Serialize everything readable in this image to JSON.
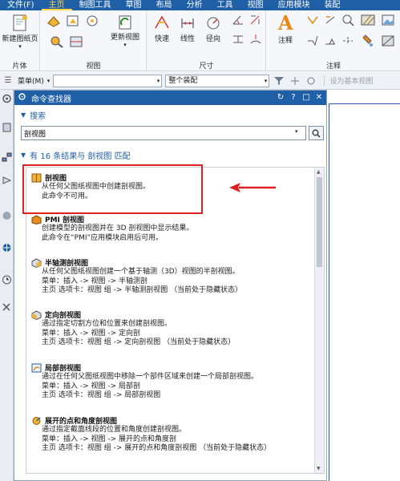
{
  "menubar": {
    "items": [
      "文件(F)",
      "主页",
      "制图工具",
      "草图",
      "布局",
      "分析",
      "工具",
      "视图",
      "应用模块",
      "装配"
    ],
    "active": "主页"
  },
  "ribbon": {
    "groups": [
      {
        "label": "片体",
        "buttons": [
          "新建图纸页"
        ]
      },
      {
        "label": "视图",
        "buttons": [
          "更新视图"
        ]
      },
      {
        "label": "尺寸",
        "buttons": [
          "快速",
          "线性",
          "径向"
        ]
      },
      {
        "label": "注释",
        "buttons": [
          "注释"
        ]
      }
    ]
  },
  "selbar": {
    "menu_label": "菜单(M)",
    "filter_value": "",
    "scope_value": "整个装配",
    "set_base_view": "设为基本视图"
  },
  "panel": {
    "title": "命令查找器",
    "search_section": "搜索",
    "search_value": "剖视图",
    "results_header": "有 16 条结果与 剖视图 匹配",
    "results": [
      {
        "title": "剖视图",
        "lines": [
          "从任何父图纸视图中创建剖视图。",
          "此命令不可用。"
        ],
        "icon": "section-view-icon"
      },
      {
        "title": "PMI 剖视图",
        "lines": [
          "创建模型的剖视图并在 3D 剖视图中显示结果。",
          "此命令在“PMI”应用模块启用后可用。"
        ],
        "icon": "pmi-section-icon"
      },
      {
        "title": "半轴测剖视图",
        "lines": [
          "从任何父图纸视图创建一个基于轴测（3D）视图的半剖视图。",
          "菜单：插入 -> 视图 -> 半轴测剖",
          "主页 选项卡：视图 组 -> 半轴测剖视图  （当前处于隐藏状态）"
        ],
        "icon": "half-pictorial-section-icon"
      },
      {
        "title": "定向剖视图",
        "lines": [
          "通过指定切割方位和位置来创建剖视图。",
          "菜单：插入 -> 视图 -> 定向剖",
          "主页 选项卡：视图 组 -> 定向剖视图  （当前处于隐藏状态）"
        ],
        "icon": "oriented-section-icon"
      },
      {
        "title": "局部剖视图",
        "lines": [
          "通过在任何父图纸视图中移除一个部件区域来创建一个局部剖视图。",
          "菜单：插入 -> 视图 -> 局部剖",
          "主页 选项卡：视图 组 -> 局部剖视图"
        ],
        "icon": "break-out-section-icon"
      },
      {
        "title": "展开的点和角度剖视图",
        "lines": [
          "通过指定截面线段的位置和角度创建剖视图。",
          "菜单：插入 -> 视图 -> 展开的点和角度剖",
          "主页 选项卡：视图 组 -> 展开的点和角度剖视图  （当前处于隐藏状态）"
        ],
        "icon": "unfolded-point-angle-section-icon"
      }
    ]
  },
  "colors": {
    "titlebar": "#1f5fa6",
    "highlight": "#e0201f",
    "accent_text": "#1f5fa6"
  }
}
